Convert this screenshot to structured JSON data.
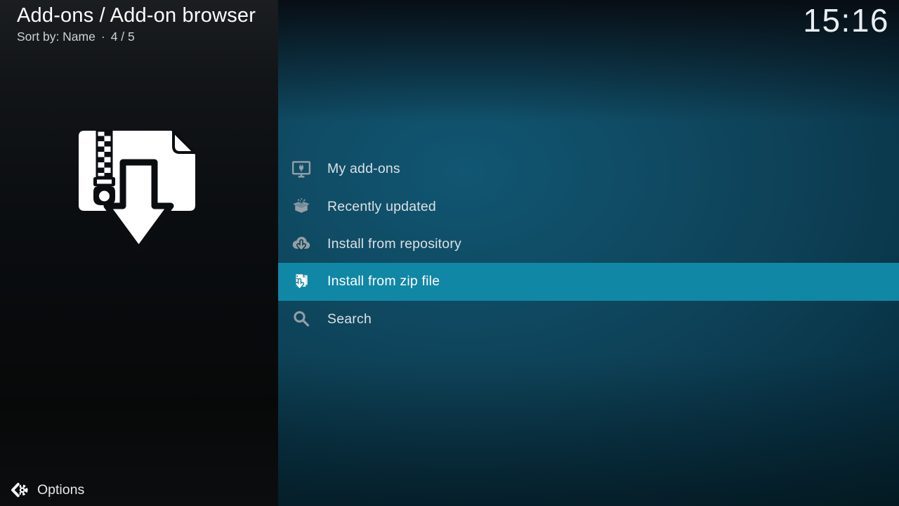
{
  "header": {
    "title": "Add-ons / Add-on browser",
    "sort_label": "Sort by: Name",
    "separator": "·",
    "position": "4 / 5",
    "clock": "15:16"
  },
  "menu": {
    "items": [
      {
        "label": "My add-ons",
        "icon": "monitor-addon-icon",
        "selected": false
      },
      {
        "label": "Recently updated",
        "icon": "open-box-icon",
        "selected": false
      },
      {
        "label": "Install from repository",
        "icon": "cloud-download-icon",
        "selected": false
      },
      {
        "label": "Install from zip file",
        "icon": "zip-download-icon",
        "selected": true
      },
      {
        "label": "Search",
        "icon": "search-icon",
        "selected": false
      }
    ]
  },
  "artwork": {
    "name": "zip-file-download-icon"
  },
  "footer": {
    "options_label": "Options"
  },
  "colors": {
    "highlight": "#1187a6",
    "icon_gray": "#93a0a6",
    "left_panel": "#0b0e10",
    "background_teal": "#0e4258"
  }
}
